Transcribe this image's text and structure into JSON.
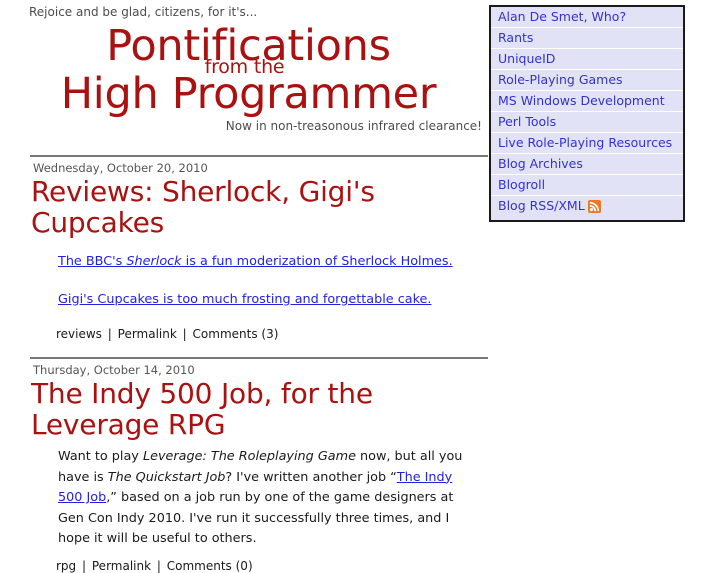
{
  "header": {
    "tagline_top": "Rejoice and be glad, citizens, for it's...",
    "title_line1": "Pontifications",
    "title_middle": "from the",
    "title_line2": "High Programmer",
    "tagline_bottom": "Now in non-treasonous infrared clearance!",
    "title_color": "#aa1111"
  },
  "sidebar": {
    "items": [
      {
        "label": "Alan De Smet, Who?",
        "icon": null
      },
      {
        "label": "Rants",
        "icon": null
      },
      {
        "label": "UniqueID",
        "icon": null
      },
      {
        "label": "Role-Playing Games",
        "icon": null
      },
      {
        "label": "MS Windows Development",
        "icon": null
      },
      {
        "label": "Perl Tools",
        "icon": null
      },
      {
        "label": "Live Role-Playing Resources",
        "icon": null
      },
      {
        "label": "Blog Archives",
        "icon": null
      },
      {
        "label": "Blogroll",
        "icon": null
      },
      {
        "label": "Blog RSS/XML",
        "icon": "rss-icon"
      }
    ],
    "link_color": "#3333cc",
    "background_color": "#e2e2f7",
    "border_color": "#1a1a1a"
  },
  "posts": [
    {
      "date": "Wednesday, October 20, 2010",
      "title": "Reviews: Sherlock, Gigi's Cupcakes",
      "paragraphs": [
        [
          {
            "text": "The BBC's ",
            "link": true,
            "italic": false
          },
          {
            "text": "Sherlock",
            "link": true,
            "italic": true
          },
          {
            "text": " is a fun moderization of Sherlock Holmes.",
            "link": true,
            "italic": false
          }
        ],
        [
          {
            "text": "Gigi's Cupcakes is too much frosting and forgettable cake.",
            "link": true,
            "italic": false
          }
        ]
      ],
      "category": "reviews",
      "permalink_label": "Permalink",
      "comments_label": "Comments (3)"
    },
    {
      "date": "Thursday, October 14, 2010",
      "title": "The Indy 500 Job, for the Leverage RPG",
      "paragraphs": [
        [
          {
            "text": "Want to play ",
            "link": false,
            "italic": false
          },
          {
            "text": "Leverage: The Roleplaying Game",
            "link": false,
            "italic": true
          },
          {
            "text": " now, but all you have is ",
            "link": false,
            "italic": false
          },
          {
            "text": "The Quickstart Job",
            "link": false,
            "italic": true
          },
          {
            "text": "? I've written another job “",
            "link": false,
            "italic": false
          },
          {
            "text": "The Indy 500 Job",
            "link": true,
            "italic": false
          },
          {
            "text": ",” based on a job run by one of the game designers at Gen Con Indy 2010. I've run it successfully three times, and I hope it will be useful to others.",
            "link": false,
            "italic": false
          }
        ]
      ],
      "category": "rpg",
      "permalink_label": "Permalink",
      "comments_label": "Comments (0)"
    }
  ],
  "separator": "|",
  "link_color": "#2222dd"
}
